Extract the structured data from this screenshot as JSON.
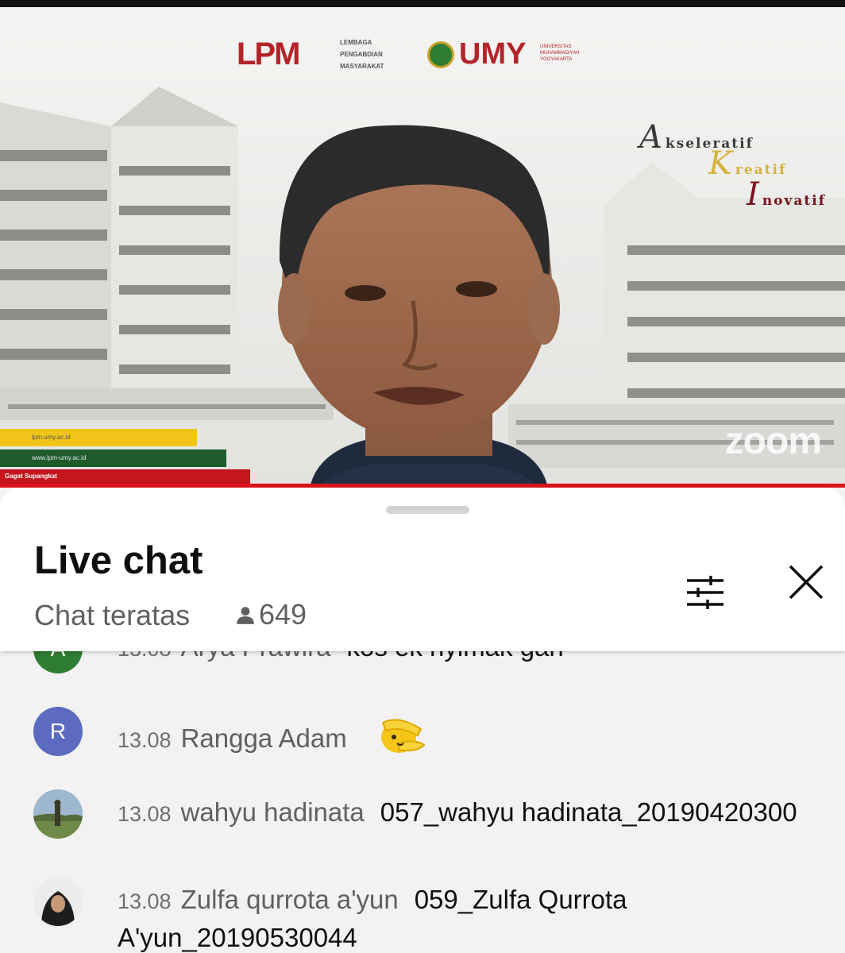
{
  "video": {
    "brand": {
      "lpm_logo": "LPM",
      "lpm_logo_sub": "umy",
      "lpm_caption": [
        "LEMBAGA",
        "PENGABDIAN",
        "MASYARAKAT"
      ],
      "umy_logo": "UMY",
      "umy_caption": [
        "UNIVERSITAS",
        "MUHAMMADIYAH",
        "YOGYAKARTA"
      ]
    },
    "tagline": [
      {
        "cap": "A",
        "rest": "kseleratif",
        "color": "#3a3a3a"
      },
      {
        "cap": "K",
        "rest": "reatif",
        "color": "#d4b43a"
      },
      {
        "cap": "I",
        "rest": "novatif",
        "color": "#7a1420"
      }
    ],
    "lower_third": {
      "website1": "lpm.umy.ac.id",
      "website2": "www.lpm-umy.ac.id",
      "speaker_name": "Gagat Supangkat"
    },
    "watermark": "zoom"
  },
  "chat": {
    "title": "Live chat",
    "mode": "Chat teratas",
    "viewer_count": "649",
    "filter_icon": "tune-icon",
    "close_icon": "close-icon",
    "partial_message": {
      "avatar_letter": "A",
      "avatar_color": "#2f7d32",
      "time": "13.08",
      "author": "Arya Prawira",
      "text": "kos ek nyimak gan"
    },
    "messages": [
      {
        "avatar_letter": "R",
        "avatar_color": "#5c6bc0",
        "time": "13.08",
        "author": "Rangga Adam",
        "text": "",
        "emoji": "dab-emoji"
      },
      {
        "avatar_letter": "",
        "avatar_color": "#8aa0b4",
        "time": "13.08",
        "author": "wahyu hadinata",
        "text": "057_wahyu hadinata_20190420300"
      },
      {
        "avatar_letter": "",
        "avatar_color": "#e6e6e6",
        "time": "13.08",
        "author": "Zulfa qurrota a'yun",
        "text": "059_Zulfa Qurrota A'yun_20190530044"
      }
    ]
  }
}
